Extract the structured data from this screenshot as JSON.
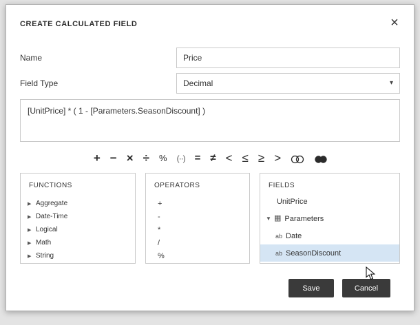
{
  "dialog": {
    "title": "CREATE CALCULATED FIELD",
    "close": "×"
  },
  "form": {
    "name": {
      "label": "Name",
      "value": "Price"
    },
    "field_type": {
      "label": "Field Type",
      "value": "Decimal",
      "caret_icon": "chevron-down-icon"
    },
    "expression": "[UnitPrice] * ( 1 - [Parameters.SeasonDiscount] )"
  },
  "operator_toolbar": {
    "buttons": [
      "+",
      "−",
      "×",
      "÷",
      "%",
      "(··)",
      "=",
      "≠",
      "<",
      "≤",
      "≥",
      ">"
    ],
    "venn_icons": [
      "intersection-icon",
      "union-icon"
    ]
  },
  "panels": {
    "functions": {
      "title": "FUNCTIONS",
      "expand_icon": "triangle-right-icon",
      "items": [
        "Aggregate",
        "Date-Time",
        "Logical",
        "Math",
        "String"
      ]
    },
    "operators": {
      "title": "OPERATORS",
      "items": [
        "+",
        "-",
        "*",
        "/",
        "%"
      ]
    },
    "fields": {
      "title": "FIELDS",
      "items": [
        {
          "label": "UnitPrice",
          "icon": "",
          "selected": false
        },
        {
          "label": "Parameters",
          "icon": "table-icon",
          "arrow": "triangle-down-icon",
          "selected": false
        },
        {
          "label": "Date",
          "icon": "ab-string-icon",
          "selected": false
        },
        {
          "label": "SeasonDiscount",
          "icon": "ab-string-icon",
          "selected": true
        }
      ],
      "ab_icon_text": "ab",
      "table_icon_glyph": "▦",
      "expanded_arrow": "▾",
      "collapsed_arrow": "▸"
    }
  },
  "footer": {
    "save": "Save",
    "cancel": "Cancel"
  },
  "colors": {
    "selection": "#d5e5f4",
    "button": "#3a3a3a",
    "page_bg": "#e3e3e3"
  }
}
